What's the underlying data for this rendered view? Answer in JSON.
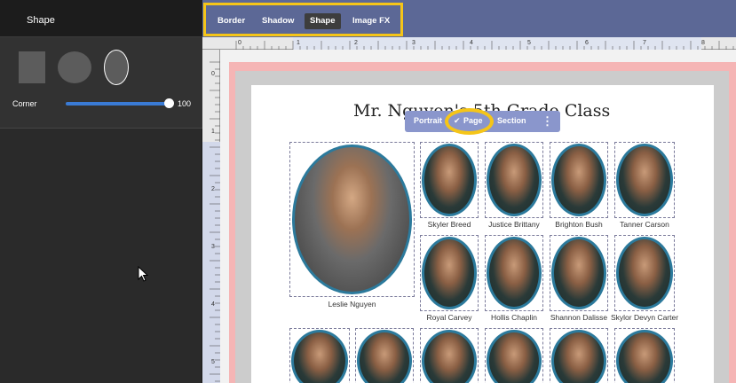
{
  "left_panel": {
    "title": "Shape",
    "corner_label": "Corner",
    "corner_value": "100",
    "corner_level": 1.0
  },
  "toolbar": {
    "tabs": [
      {
        "label": "Border"
      },
      {
        "label": "Shadow"
      },
      {
        "label": "Shape",
        "active": true
      },
      {
        "label": "Image FX"
      }
    ],
    "highlight_color": "#f5c518",
    "bar_color": "#5c6896"
  },
  "ruler": {
    "top_numbers": [
      "0",
      "1",
      "2",
      "3",
      "4",
      "5",
      "6",
      "7",
      "8"
    ],
    "left_numbers": [
      "0",
      "1",
      "2",
      "3",
      "4",
      "5"
    ]
  },
  "page": {
    "title": "Mr. Nguyen's 5th Grade Class"
  },
  "floating_menu": {
    "items": [
      "Portrait",
      "Page",
      "Section"
    ],
    "selected": "Page",
    "more_icon": "vertical-dots-icon",
    "check_icon": "check-icon"
  },
  "portraits": {
    "teacher": "Leslie Nguyen",
    "students": [
      "Skyler Breed",
      "Justice Brittany",
      "Brighton Bush",
      "Tanner Carson",
      "Royal Carvey",
      "Hollis Chaplin",
      "Shannon Dalisse",
      "Skylor Devyn Carter"
    ]
  }
}
